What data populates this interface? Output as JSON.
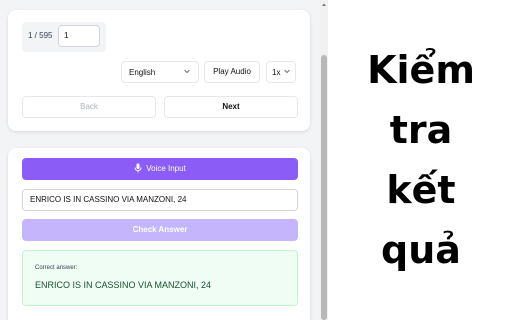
{
  "pager": {
    "label": "1 / 595",
    "value": "1"
  },
  "language_select": {
    "value": "English"
  },
  "play_audio_label": "Play Audio",
  "speed_select": {
    "value": "1x"
  },
  "back_label": "Back",
  "next_label": "Next",
  "voice_input_label": "Voice Input",
  "answer_input": {
    "value": "ENRICO IS IN CASSINO VIA MANZONI, 24"
  },
  "check_answer_label": "Check Answer",
  "result": {
    "label": "Correct answer:",
    "value": "ENRICO IS IN CASSINO VIA MANZONI, 24"
  },
  "caption_lines": [
    "Kiểm",
    "tra",
    "kết",
    "quả"
  ],
  "colors": {
    "accent": "#8b5cf6",
    "accent_disabled": "#c4b5fd",
    "success_bg": "#f0fdf4"
  }
}
